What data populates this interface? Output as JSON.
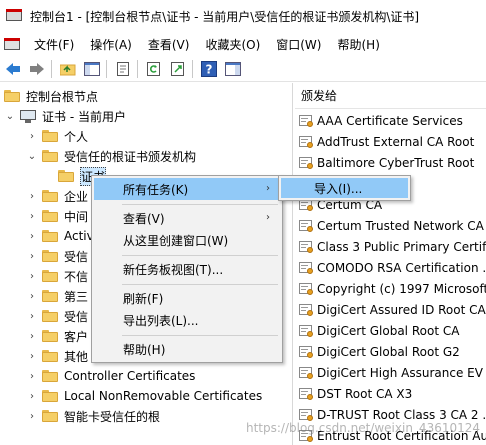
{
  "window": {
    "title": "控制台1 - [控制台根节点\\证书 - 当前用户\\受信任的根证书颁发机构\\证书]"
  },
  "menubar": {
    "items": [
      "文件(F)",
      "操作(A)",
      "查看(V)",
      "收藏夹(O)",
      "窗口(W)",
      "帮助(H)"
    ]
  },
  "toolbar": {
    "icons": [
      "back-icon",
      "forward-icon",
      "up-folder-icon",
      "show-tree-icon",
      "properties-icon",
      "refresh-icon",
      "export-icon",
      "help-icon",
      "show-action-pane-icon"
    ]
  },
  "tree": {
    "root": "控制台根节点",
    "store": "证书 - 当前用户",
    "items": [
      "个人",
      "受信任的根证书颁发机构",
      "证书",
      "企业",
      "中间",
      "Active",
      "受信",
      "不信",
      "第三",
      "受信",
      "客户",
      "其他",
      "Controller Certificates",
      "Local NonRemovable Certificates",
      "智能卡受信任的根"
    ]
  },
  "list": {
    "header": "颁发给",
    "rows": [
      "AAA Certificate Services",
      "AddTrust External CA Root",
      "Baltimore CyberTrust Root",
      "er",
      "Certum CA",
      "Certum Trusted Network CA",
      "Class 3 Public Primary Certifi...",
      "COMODO RSA Certification ...",
      "Copyright (c) 1997 Microsoft",
      "DigiCert Assured ID Root CA",
      "DigiCert Global Root CA",
      "DigiCert Global Root G2",
      "DigiCert High Assurance EV ...",
      "DST Root CA X3",
      "D-TRUST Root Class 3 CA 2 ...",
      "Entrust Root Certification Au..."
    ]
  },
  "context_menu": {
    "items": [
      "所有任务(K)",
      "查看(V)",
      "从这里创建窗口(W)",
      "新任务板视图(T)...",
      "刷新(F)",
      "导出列表(L)...",
      "帮助(H)"
    ]
  },
  "submenu": {
    "items": [
      "导入(I)..."
    ]
  },
  "watermark": "https://blog.csdn.net/weixin_43610124"
}
